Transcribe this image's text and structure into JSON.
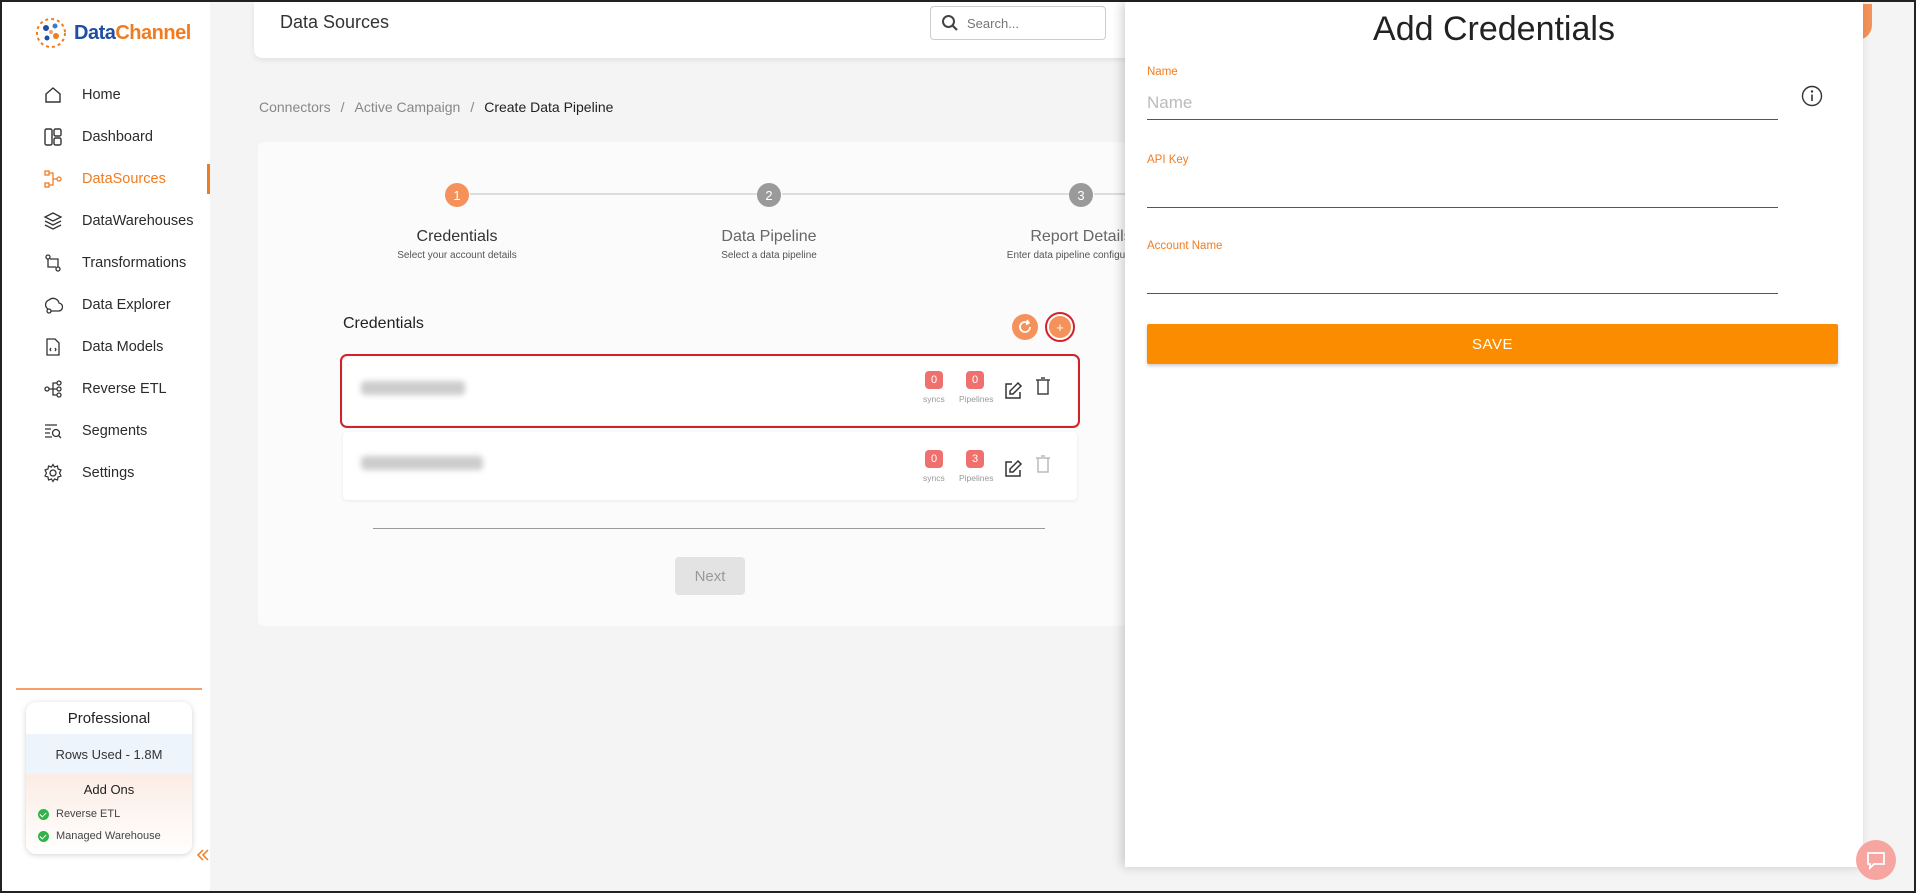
{
  "brand": {
    "part1": "Data",
    "part2": "Channel"
  },
  "sidebar": {
    "items": [
      {
        "label": "Home",
        "icon": "home-icon"
      },
      {
        "label": "Dashboard",
        "icon": "dashboard-icon"
      },
      {
        "label": "DataSources",
        "icon": "datasources-icon",
        "active": true
      },
      {
        "label": "DataWarehouses",
        "icon": "layers-icon"
      },
      {
        "label": "Transformations",
        "icon": "transform-icon"
      },
      {
        "label": "Data Explorer",
        "icon": "explorer-icon"
      },
      {
        "label": "Data Models",
        "icon": "models-icon"
      },
      {
        "label": "Reverse ETL",
        "icon": "reverse-etl-icon"
      },
      {
        "label": "Segments",
        "icon": "segments-icon"
      },
      {
        "label": "Settings",
        "icon": "gear-icon"
      }
    ],
    "plan": {
      "name": "Professional",
      "rows_used": "Rows Used - 1.8M",
      "addons_title": "Add Ons",
      "addons": [
        "Reverse ETL",
        "Managed Warehouse"
      ]
    }
  },
  "header": {
    "title": "Data Sources",
    "search_placeholder": "Search..."
  },
  "breadcrumb": {
    "items": [
      "Connectors",
      "Active Campaign",
      "Create Data Pipeline"
    ],
    "separator": "/"
  },
  "stepper": {
    "steps": [
      {
        "num": "1",
        "title": "Credentials",
        "sub": "Select your account details"
      },
      {
        "num": "2",
        "title": "Data Pipeline",
        "sub": "Select a data pipeline"
      },
      {
        "num": "3",
        "title": "Report Details",
        "sub": "Enter data pipeline configurations"
      }
    ]
  },
  "credentials": {
    "heading": "Credentials",
    "rows": [
      {
        "syncs": "0",
        "syncs_label": "syncs",
        "pipelines": "0",
        "pipelines_label": "Pipelines"
      },
      {
        "syncs": "0",
        "syncs_label": "syncs",
        "pipelines": "3",
        "pipelines_label": "Pipelines"
      }
    ],
    "add_label": "+",
    "next_label": "Next"
  },
  "drawer": {
    "title": "Add Credentials",
    "fields": [
      {
        "label": "Name",
        "placeholder": "Name",
        "value": ""
      },
      {
        "label": "API Key",
        "placeholder": "",
        "value": ""
      },
      {
        "label": "Account Name",
        "placeholder": "",
        "value": ""
      }
    ],
    "save_label": "SAVE"
  },
  "colors": {
    "accent": "#f07c22",
    "save": "#fb8c00",
    "highlight": "#d0222a",
    "badge": "#f07070"
  }
}
